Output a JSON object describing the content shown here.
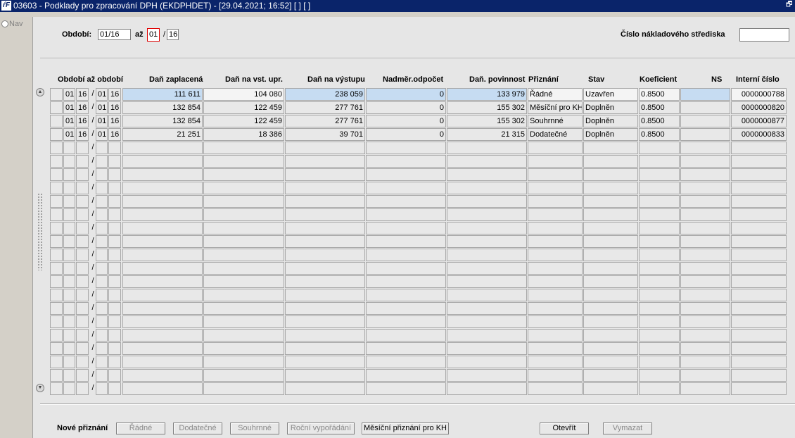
{
  "window": {
    "title": "03603 - Podklady pro zpracování DPH (EKDPHDET) - [29.04.2021; 16:52]  [ ] [ ]",
    "app_icon_text": "ŕF",
    "restore_glyph": "🗗"
  },
  "nav": {
    "label": "Nav"
  },
  "filter": {
    "period_label": "Období:",
    "period_from": "01/16",
    "to_label": "až",
    "period_to_month": "01",
    "period_to_sep": "/",
    "period_to_year": "16",
    "cost_center_label": "Číslo nákladového střediska",
    "cost_center_value": ""
  },
  "columns": {
    "period": "Období až období",
    "tax_paid": "Daň zaplacená",
    "tax_input_adj": "Daň na vst. upr.",
    "tax_output": "Daň na výstupu",
    "excess_deduction": "Nadměr.odpočet",
    "tax_liability": "Daň. povinnost",
    "return": "Přiznání",
    "status": "Stav",
    "coefficient": "Koeficient",
    "ns": "NS",
    "internal_no": "Interní číslo"
  },
  "rows": [
    {
      "from_m": "01",
      "from_y": "16",
      "to_m": "01",
      "to_y": "16",
      "tax_paid": "111 611",
      "tax_input_adj": "104 080",
      "tax_output": "238 059",
      "excess": "0",
      "liability": "133 979",
      "return": "Řádné",
      "status": "Uzavřen",
      "coef": "0.8500",
      "ns": "",
      "internal": "0000000788"
    },
    {
      "from_m": "01",
      "from_y": "16",
      "to_m": "01",
      "to_y": "16",
      "tax_paid": "132 854",
      "tax_input_adj": "122 459",
      "tax_output": "277 761",
      "excess": "0",
      "liability": "155 302",
      "return": "Měsíční pro KH",
      "status": "Doplněn",
      "coef": "0.8500",
      "ns": "",
      "internal": "0000000820"
    },
    {
      "from_m": "01",
      "from_y": "16",
      "to_m": "01",
      "to_y": "16",
      "tax_paid": "132 854",
      "tax_input_adj": "122 459",
      "tax_output": "277 761",
      "excess": "0",
      "liability": "155 302",
      "return": "Souhrnné",
      "status": "Doplněn",
      "coef": "0.8500",
      "ns": "",
      "internal": "0000000877"
    },
    {
      "from_m": "01",
      "from_y": "16",
      "to_m": "01",
      "to_y": "16",
      "tax_paid": "21 251",
      "tax_input_adj": "18 386",
      "tax_output": "39 701",
      "excess": "0",
      "liability": "21 315",
      "return": "Dodatečné",
      "status": "Doplněn",
      "coef": "0.8500",
      "ns": "",
      "internal": "0000000833"
    }
  ],
  "empty_rows": 19,
  "period_slash": "/",
  "scroll": {
    "up": "▲",
    "down": "▼"
  },
  "footer": {
    "new_return_label": "Nové přiznání",
    "buttons": {
      "regular": "Řádné",
      "supplementary": "Dodatečné",
      "summary": "Souhrnné",
      "annual": "Roční vypořádání",
      "monthly_kh": "Měsíční přiznání pro KH",
      "open": "Otevřít",
      "delete": "Vymazat"
    }
  },
  "colors": {
    "titlebar": "#0a246a",
    "selected_row": "#c6dcf2",
    "cell_bg": "#e8e8e8",
    "panel_bg": "#e6e6e6"
  }
}
